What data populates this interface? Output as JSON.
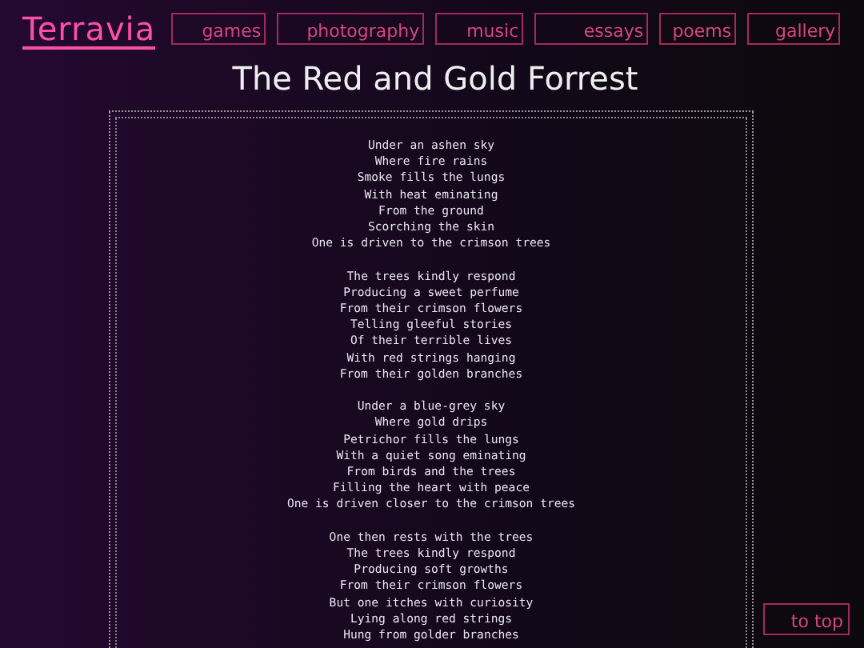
{
  "site_title": "Terravia",
  "nav": [
    "games",
    "photography",
    "music",
    "essays",
    "poems",
    "gallery"
  ],
  "title": "The Red and Gold Forrest",
  "poem": [
    [
      "Under an ashen sky",
      "Where fire rains",
      "Smoke fills the lungs",
      "With heat eminating",
      "From the ground",
      "Scorching the skin",
      "One is driven to the crimson trees"
    ],
    [
      "The trees kindly respond",
      "Producing a sweet perfume",
      "From their crimson flowers",
      "Telling gleeful stories",
      "Of their terrible lives",
      "With red strings hanging",
      "From their golden branches"
    ],
    [
      "Under a blue-grey sky",
      "Where gold drips",
      "Petrichor fills the lungs",
      "With a quiet song eminating",
      "From birds and the trees",
      "Filling the heart with peace",
      "One is driven closer to the crimson trees"
    ],
    [
      "One then rests with the trees",
      "The trees kindly respond",
      "Producing soft growths",
      "From their crimson flowers",
      "But one itches with curiosity",
      "Lying along red strings",
      "Hung from golder branches"
    ]
  ],
  "to_top": "to top"
}
